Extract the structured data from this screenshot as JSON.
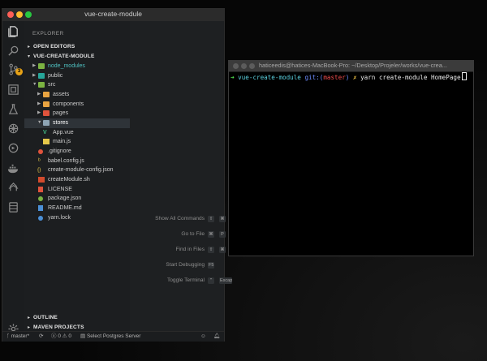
{
  "vscode": {
    "window_title": "vue-create-module",
    "activity_badge": "3",
    "sidebar": {
      "title": "EXPLORER",
      "open_editors": "OPEN EDITORS",
      "project": "VUE-CREATE-MODULE",
      "items": [
        {
          "name": "node_modules",
          "color": "#4fc1c1"
        },
        {
          "name": "public",
          "color": "#cbcbcb"
        },
        {
          "name": "src",
          "color": "#cbcbcb"
        },
        {
          "name": "assets",
          "color": "#cbcbcb"
        },
        {
          "name": "components",
          "color": "#cbcbcb"
        },
        {
          "name": "pages",
          "color": "#cbcbcb"
        },
        {
          "name": "stores",
          "color": "#ffffff"
        },
        {
          "name": "App.vue",
          "color": "#cbcbcb"
        },
        {
          "name": "main.js",
          "color": "#cbcbcb"
        },
        {
          "name": ".gitignore",
          "color": "#cbcbcb"
        },
        {
          "name": "babel.config.js",
          "color": "#cbcbcb"
        },
        {
          "name": "create-module-config.json",
          "color": "#cbcbcb"
        },
        {
          "name": "createModule.sh",
          "color": "#cbcbcb"
        },
        {
          "name": "LICENSE",
          "color": "#cbcbcb"
        },
        {
          "name": "package.json",
          "color": "#cbcbcb"
        },
        {
          "name": "README.md",
          "color": "#cbcbcb"
        },
        {
          "name": "yarn.lock",
          "color": "#cbcbcb"
        }
      ],
      "outline": "OUTLINE",
      "maven": "MAVEN PROJECTS"
    },
    "shortcuts": [
      {
        "label": "Show All Commands",
        "keys": [
          "⇧",
          "⌘",
          "P"
        ]
      },
      {
        "label": "Go to File",
        "keys": [
          "⌘",
          "P"
        ]
      },
      {
        "label": "Find in Files",
        "keys": [
          "⇧",
          "⌘",
          "F"
        ]
      },
      {
        "label": "Start Debugging",
        "keys": [
          "F5"
        ]
      },
      {
        "label": "Toggle Terminal",
        "keys": [
          "⌃",
          "Escap"
        ]
      }
    ],
    "status": {
      "branch": "master*",
      "errors": "0",
      "warnings": "0",
      "server": "Select Postgres Server"
    }
  },
  "terminal": {
    "title": "haticeedis@hatices-MacBook-Pro: ~/Desktop/Projeler/works/vue-crea...",
    "arrow": "➜",
    "dir": "vue-create-module",
    "git_label": "git:",
    "branch_open": "(",
    "branch": "master",
    "branch_close": ")",
    "dirty": "✗",
    "command": "yarn create-module HomePage"
  }
}
